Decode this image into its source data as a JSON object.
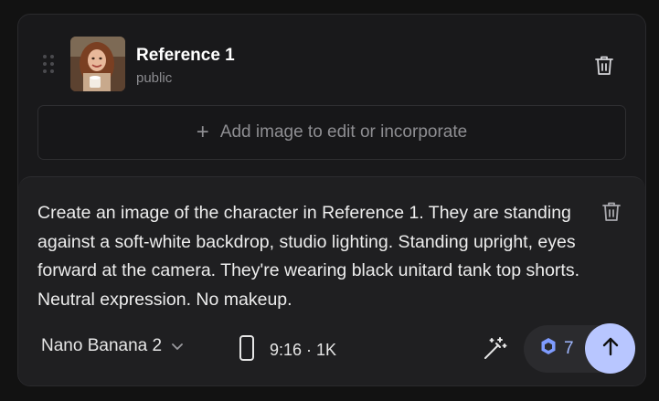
{
  "reference": {
    "title": "Reference 1",
    "visibility": "public",
    "thumbnail_icon": "portrait-photo"
  },
  "add_image": {
    "label": "Add image to edit or incorporate",
    "icon": "plus-icon"
  },
  "composer": {
    "prompt": "Create an image of the character in Reference 1. They are standing against a soft-white backdrop, studio lighting. Standing upright, eyes forward at the camera. They're wearing black unitard tank top shorts. Neutral expression. No makeup.",
    "model": "Nano Banana 2",
    "aspect": "9:16 · 1K",
    "credits": "7"
  },
  "colors": {
    "background": "#121212",
    "panel": "#19191b",
    "composer": "#1f1f21",
    "accent": "#b8c6ff",
    "credit_text": "#9fb7ff"
  }
}
